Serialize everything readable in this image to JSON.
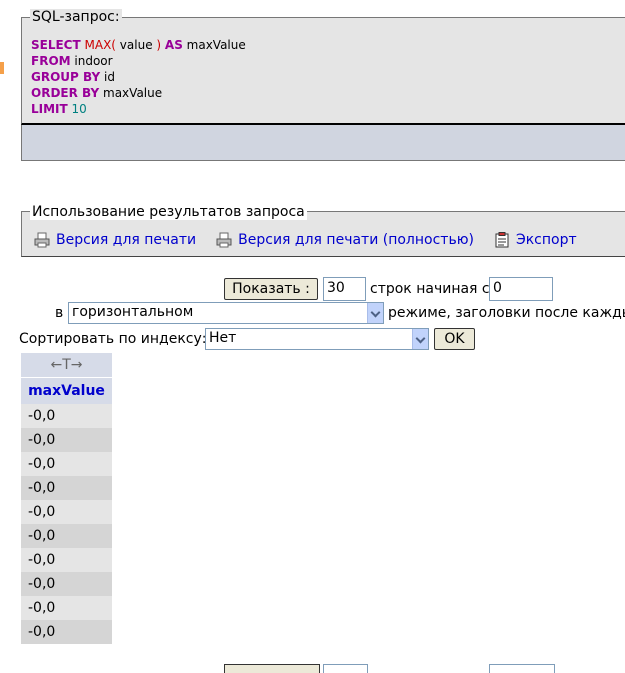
{
  "sql": {
    "legend": "SQL-запрос:",
    "lines": [
      [
        {
          "t": "SELECT",
          "c": "kw"
        },
        {
          "t": " "
        },
        {
          "t": "MAX(",
          "c": "fn"
        },
        {
          "t": " value ",
          "c": "id"
        },
        {
          "t": ")",
          "c": "fn"
        },
        {
          "t": " "
        },
        {
          "t": "AS",
          "c": "kw"
        },
        {
          "t": " maxValue",
          "c": "id"
        }
      ],
      [
        {
          "t": "FROM",
          "c": "kw"
        },
        {
          "t": " indoor",
          "c": "id"
        }
      ],
      [
        {
          "t": "GROUP BY",
          "c": "kw"
        },
        {
          "t": " id",
          "c": "id"
        }
      ],
      [
        {
          "t": "ORDER BY",
          "c": "kw"
        },
        {
          "t": " maxValue",
          "c": "id"
        }
      ],
      [
        {
          "t": "LIMIT",
          "c": "kw"
        },
        {
          "t": " "
        },
        {
          "t": "10",
          "c": "num"
        }
      ]
    ]
  },
  "query_results": {
    "legend": "Использование результатов запроса",
    "print_label": "Версия для печати",
    "print_full_label": "Версия для печати (полностью)",
    "export_label": "Экспорт"
  },
  "nav": {
    "show_button": "Показать :",
    "rows_value": "30",
    "rows_from_label": "строк начиная с",
    "start_value": "0",
    "in_label": "в",
    "mode_value": "горизонтальном",
    "mode_suffix": "режиме, заголовки после каждых"
  },
  "sort": {
    "label": "Сортировать по индексу:",
    "value": "Нет",
    "ok_button": "OK"
  },
  "table": {
    "arrows": "←T→",
    "column": "maxValue",
    "rows": [
      "-0,0",
      "-0,0",
      "-0,0",
      "-0,0",
      "-0,0",
      "-0,0",
      "-0,0",
      "-0,0",
      "-0,0",
      "-0,0"
    ]
  },
  "colors": {
    "keyword": "#990099",
    "function": "#cc0000",
    "number": "#008080",
    "link": "#0000cc"
  }
}
